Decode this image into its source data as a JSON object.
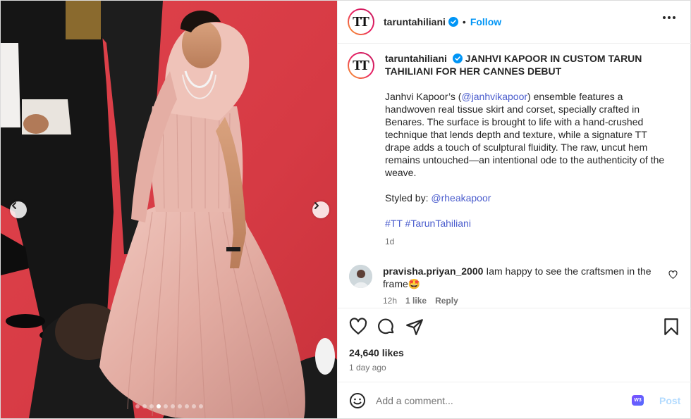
{
  "account": {
    "username": "taruntahiliani",
    "follow_label": "Follow",
    "bullet": "•",
    "logo_text": "TT"
  },
  "caption": {
    "username": "taruntahiliani",
    "headline": "JANHVI KAPOOR IN CUSTOM TARUN TAHILIANI FOR HER CANNES DEBUT",
    "para1_a": "Janhvi Kapoor’s (",
    "para1_mention": "@janhvikapoor",
    "para1_b": ") ensemble features a handwoven real tissue skirt and corset, specially crafted in Benares. The surface is brought to life with a hand-crushed technique that lends depth and texture, while a signature TT drape adds a touch of sculptural fluidity. The raw, uncut hem remains untouched—an intentional ode to the authenticity of the weave.",
    "styled_by_label": "Styled by: ",
    "styled_by_mention": "@rheakapoor",
    "hashtag1": "#TT",
    "hashtag2": "#TarunTahiliani",
    "time": "1d"
  },
  "comment": {
    "username": "pravisha.priyan_2000",
    "text": "Iam happy to see the craftsmen in the frame",
    "emoji": "🤩",
    "time": "12h",
    "likes": "1 like",
    "reply_label": "Reply"
  },
  "stats": {
    "likes": "24,640 likes",
    "posted": "1 day ago"
  },
  "composer": {
    "placeholder": "Add a comment...",
    "post_label": "Post",
    "extension_badge": "W3"
  },
  "carousel": {
    "slide_count": 10,
    "active_index": 3
  },
  "colors": {
    "link": "#4a5ccd",
    "follow": "#0095f6",
    "verified": "#0095f6",
    "post_disabled": "#b3dbff",
    "carpet": "#d63a44",
    "gown": "#e6b3aa"
  },
  "icons": [
    "verified-badge-icon",
    "more-options-icon",
    "heart-icon",
    "comment-icon",
    "share-icon",
    "save-icon",
    "emoji-icon",
    "chevron-left-icon",
    "chevron-right-icon"
  ]
}
